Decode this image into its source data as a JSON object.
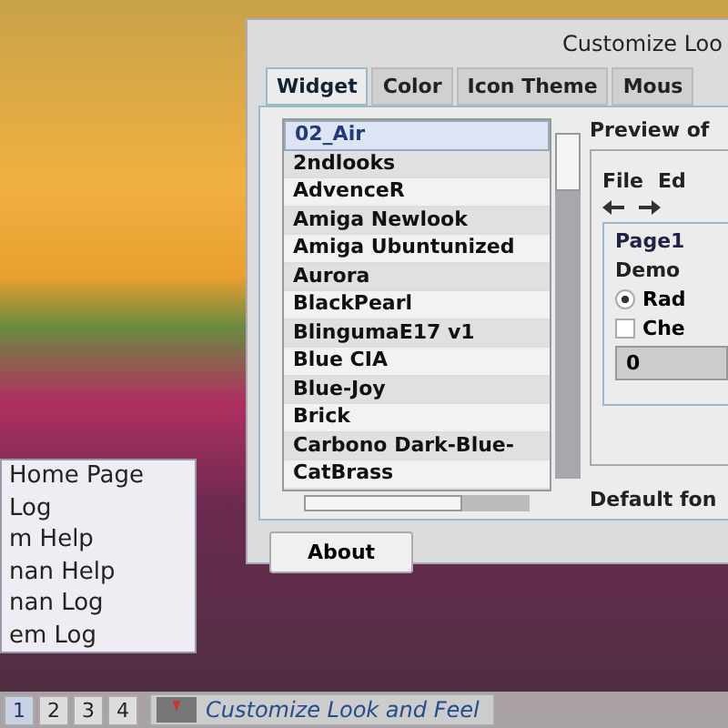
{
  "window": {
    "title": "Customize Loo"
  },
  "tabs": [
    {
      "label": "Widget",
      "selected": true
    },
    {
      "label": "Color",
      "selected": false
    },
    {
      "label": "Icon Theme",
      "selected": false
    },
    {
      "label": "Mous",
      "selected": false
    }
  ],
  "theme_list": [
    {
      "label": "02_Air",
      "selected": true
    },
    {
      "label": "2ndlooks",
      "selected": false
    },
    {
      "label": "AdvenceR",
      "selected": false
    },
    {
      "label": "Amiga Newlook",
      "selected": false
    },
    {
      "label": "Amiga Ubuntunized",
      "selected": false
    },
    {
      "label": "Aurora",
      "selected": false
    },
    {
      "label": "BlackPearl",
      "selected": false
    },
    {
      "label": "BlingumaE17 v1",
      "selected": false
    },
    {
      "label": "Blue CIA",
      "selected": false
    },
    {
      "label": "Blue-Joy",
      "selected": false
    },
    {
      "label": "Brick",
      "selected": false
    },
    {
      "label": "Carbono Dark-Blue-",
      "selected": false
    },
    {
      "label": "CatBrass",
      "selected": false
    }
  ],
  "preview": {
    "title": "Preview of",
    "menu": [
      "File",
      "Ed"
    ],
    "page_tab": "Page1",
    "group": "Demo",
    "radio": {
      "label": "Rad",
      "checked": true
    },
    "checkbox": {
      "label": "Che",
      "checked": false
    },
    "spin_value": "0"
  },
  "default_font_label": "Default fon",
  "about_button": "About",
  "popup_menu": [
    "Home Page",
    "Log",
    "m Help",
    "nan Help",
    "nan Log",
    "em Log"
  ],
  "taskbar": {
    "workspaces": [
      {
        "label": "1",
        "selected": true
      },
      {
        "label": "2",
        "selected": false
      },
      {
        "label": "3",
        "selected": false
      },
      {
        "label": "4",
        "selected": false
      }
    ],
    "task": "Customize Look and Feel"
  }
}
